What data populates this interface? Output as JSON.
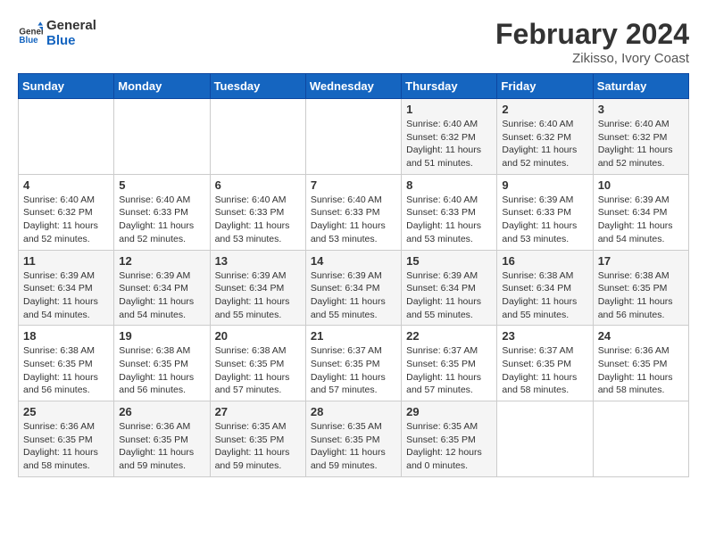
{
  "header": {
    "logo_line1": "General",
    "logo_line2": "Blue",
    "title": "February 2024",
    "subtitle": "Zikisso, Ivory Coast"
  },
  "days_of_week": [
    "Sunday",
    "Monday",
    "Tuesday",
    "Wednesday",
    "Thursday",
    "Friday",
    "Saturday"
  ],
  "weeks": [
    [
      {
        "day": "",
        "info": ""
      },
      {
        "day": "",
        "info": ""
      },
      {
        "day": "",
        "info": ""
      },
      {
        "day": "",
        "info": ""
      },
      {
        "day": "1",
        "info": "Sunrise: 6:40 AM\nSunset: 6:32 PM\nDaylight: 11 hours\nand 51 minutes."
      },
      {
        "day": "2",
        "info": "Sunrise: 6:40 AM\nSunset: 6:32 PM\nDaylight: 11 hours\nand 52 minutes."
      },
      {
        "day": "3",
        "info": "Sunrise: 6:40 AM\nSunset: 6:32 PM\nDaylight: 11 hours\nand 52 minutes."
      }
    ],
    [
      {
        "day": "4",
        "info": "Sunrise: 6:40 AM\nSunset: 6:32 PM\nDaylight: 11 hours\nand 52 minutes."
      },
      {
        "day": "5",
        "info": "Sunrise: 6:40 AM\nSunset: 6:33 PM\nDaylight: 11 hours\nand 52 minutes."
      },
      {
        "day": "6",
        "info": "Sunrise: 6:40 AM\nSunset: 6:33 PM\nDaylight: 11 hours\nand 53 minutes."
      },
      {
        "day": "7",
        "info": "Sunrise: 6:40 AM\nSunset: 6:33 PM\nDaylight: 11 hours\nand 53 minutes."
      },
      {
        "day": "8",
        "info": "Sunrise: 6:40 AM\nSunset: 6:33 PM\nDaylight: 11 hours\nand 53 minutes."
      },
      {
        "day": "9",
        "info": "Sunrise: 6:39 AM\nSunset: 6:33 PM\nDaylight: 11 hours\nand 53 minutes."
      },
      {
        "day": "10",
        "info": "Sunrise: 6:39 AM\nSunset: 6:34 PM\nDaylight: 11 hours\nand 54 minutes."
      }
    ],
    [
      {
        "day": "11",
        "info": "Sunrise: 6:39 AM\nSunset: 6:34 PM\nDaylight: 11 hours\nand 54 minutes."
      },
      {
        "day": "12",
        "info": "Sunrise: 6:39 AM\nSunset: 6:34 PM\nDaylight: 11 hours\nand 54 minutes."
      },
      {
        "day": "13",
        "info": "Sunrise: 6:39 AM\nSunset: 6:34 PM\nDaylight: 11 hours\nand 55 minutes."
      },
      {
        "day": "14",
        "info": "Sunrise: 6:39 AM\nSunset: 6:34 PM\nDaylight: 11 hours\nand 55 minutes."
      },
      {
        "day": "15",
        "info": "Sunrise: 6:39 AM\nSunset: 6:34 PM\nDaylight: 11 hours\nand 55 minutes."
      },
      {
        "day": "16",
        "info": "Sunrise: 6:38 AM\nSunset: 6:34 PM\nDaylight: 11 hours\nand 55 minutes."
      },
      {
        "day": "17",
        "info": "Sunrise: 6:38 AM\nSunset: 6:35 PM\nDaylight: 11 hours\nand 56 minutes."
      }
    ],
    [
      {
        "day": "18",
        "info": "Sunrise: 6:38 AM\nSunset: 6:35 PM\nDaylight: 11 hours\nand 56 minutes."
      },
      {
        "day": "19",
        "info": "Sunrise: 6:38 AM\nSunset: 6:35 PM\nDaylight: 11 hours\nand 56 minutes."
      },
      {
        "day": "20",
        "info": "Sunrise: 6:38 AM\nSunset: 6:35 PM\nDaylight: 11 hours\nand 57 minutes."
      },
      {
        "day": "21",
        "info": "Sunrise: 6:37 AM\nSunset: 6:35 PM\nDaylight: 11 hours\nand 57 minutes."
      },
      {
        "day": "22",
        "info": "Sunrise: 6:37 AM\nSunset: 6:35 PM\nDaylight: 11 hours\nand 57 minutes."
      },
      {
        "day": "23",
        "info": "Sunrise: 6:37 AM\nSunset: 6:35 PM\nDaylight: 11 hours\nand 58 minutes."
      },
      {
        "day": "24",
        "info": "Sunrise: 6:36 AM\nSunset: 6:35 PM\nDaylight: 11 hours\nand 58 minutes."
      }
    ],
    [
      {
        "day": "25",
        "info": "Sunrise: 6:36 AM\nSunset: 6:35 PM\nDaylight: 11 hours\nand 58 minutes."
      },
      {
        "day": "26",
        "info": "Sunrise: 6:36 AM\nSunset: 6:35 PM\nDaylight: 11 hours\nand 59 minutes."
      },
      {
        "day": "27",
        "info": "Sunrise: 6:35 AM\nSunset: 6:35 PM\nDaylight: 11 hours\nand 59 minutes."
      },
      {
        "day": "28",
        "info": "Sunrise: 6:35 AM\nSunset: 6:35 PM\nDaylight: 11 hours\nand 59 minutes."
      },
      {
        "day": "29",
        "info": "Sunrise: 6:35 AM\nSunset: 6:35 PM\nDaylight: 12 hours\nand 0 minutes."
      },
      {
        "day": "",
        "info": ""
      },
      {
        "day": "",
        "info": ""
      }
    ]
  ]
}
